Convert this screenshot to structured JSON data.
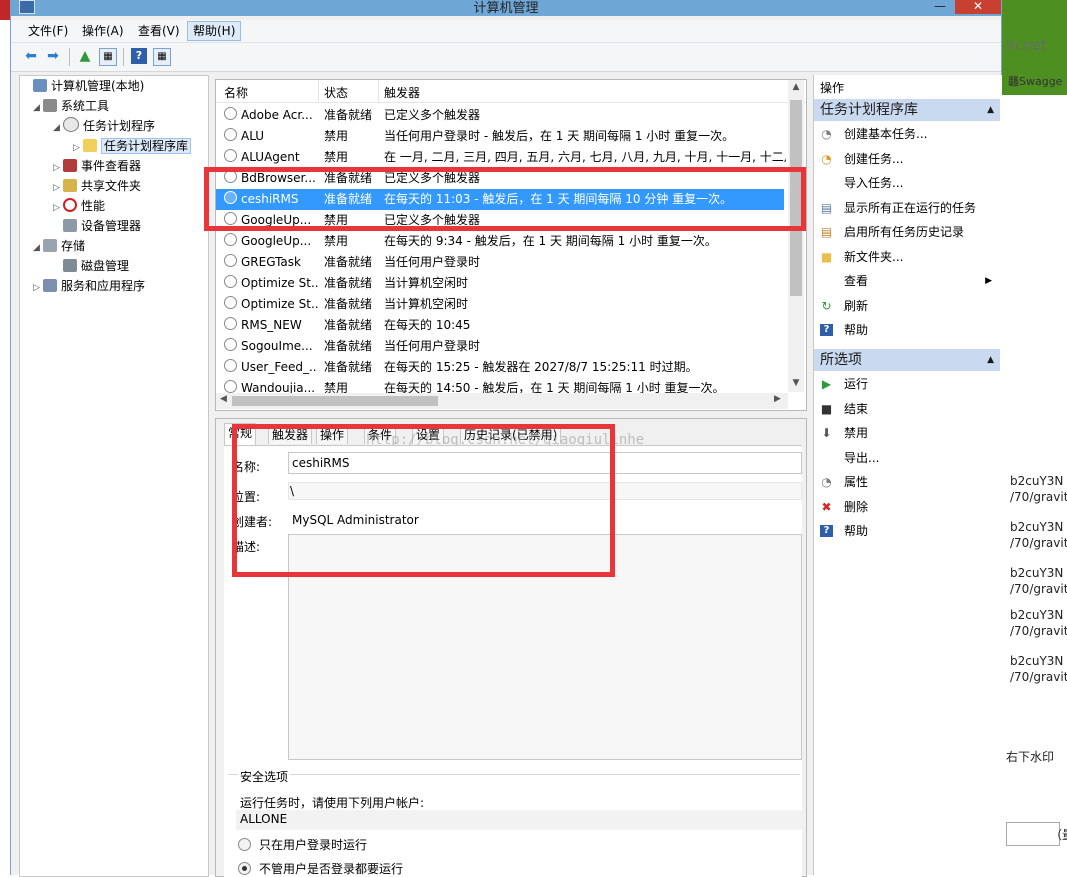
{
  "window": {
    "title": "计算机管理",
    "minimize": "—",
    "close": "✕"
  },
  "menubar": {
    "items": [
      "文件(F)",
      "操作(A)",
      "查看(V)",
      "帮助(H)"
    ]
  },
  "tree": {
    "items": [
      {
        "label": "计算机管理(本地)",
        "level": 0,
        "expander": "",
        "icon": "computer-icon"
      },
      {
        "label": "系统工具",
        "level": 1,
        "expander": "◢",
        "icon": "tools-icon"
      },
      {
        "label": "任务计划程序",
        "level": 2,
        "expander": "◢",
        "icon": "clock-icon"
      },
      {
        "label": "任务计划程序库",
        "level": 3,
        "expander": "▷",
        "icon": "folder-icon",
        "selected": true
      },
      {
        "label": "事件查看器",
        "level": 2,
        "expander": "▷",
        "icon": "event-viewer-icon"
      },
      {
        "label": "共享文件夹",
        "level": 2,
        "expander": "▷",
        "icon": "shared-folder-icon"
      },
      {
        "label": "性能",
        "level": 2,
        "expander": "▷",
        "icon": "performance-icon"
      },
      {
        "label": "设备管理器",
        "level": 2,
        "expander": "",
        "icon": "device-manager-icon"
      },
      {
        "label": "存储",
        "level": 1,
        "expander": "◢",
        "icon": "storage-icon"
      },
      {
        "label": "磁盘管理",
        "level": 2,
        "expander": "",
        "icon": "disk-icon"
      },
      {
        "label": "服务和应用程序",
        "level": 1,
        "expander": "▷",
        "icon": "services-icon"
      }
    ]
  },
  "tasklist": {
    "columns": [
      "名称",
      "状态",
      "触发器"
    ],
    "rows": [
      {
        "name": "Adobe Acr...",
        "status": "准备就绪",
        "trigger": "已定义多个触发器"
      },
      {
        "name": "ALU",
        "status": "禁用",
        "trigger": "当任何用户登录时 - 触发后，在 1 天 期间每隔 1 小时 重复一次。"
      },
      {
        "name": "ALUAgent",
        "status": "禁用",
        "trigger": "在 一月, 二月, 三月, 四月, 五月, 六月, 七月, 八月, 九月, 十月, 十一月, 十二月"
      },
      {
        "name": "BdBrowser...",
        "status": "准备就绪",
        "trigger": "已定义多个触发器"
      },
      {
        "name": "ceshiRMS",
        "status": "准备就绪",
        "trigger": "在每天的 11:03 - 触发后，在 1 天 期间每隔 10 分钟 重复一次。",
        "selected": true
      },
      {
        "name": "GoogleUp...",
        "status": "禁用",
        "trigger": "已定义多个触发器"
      },
      {
        "name": "GoogleUp...",
        "status": "禁用",
        "trigger": "在每天的 9:34 - 触发后，在 1 天 期间每隔 1 小时 重复一次。"
      },
      {
        "name": "GREGTask",
        "status": "准备就绪",
        "trigger": "当任何用户登录时"
      },
      {
        "name": "Optimize St...",
        "status": "准备就绪",
        "trigger": "当计算机空闲时"
      },
      {
        "name": "Optimize St...",
        "status": "准备就绪",
        "trigger": "当计算机空闲时"
      },
      {
        "name": "RMS_NEW",
        "status": "准备就绪",
        "trigger": "在每天的 10:45"
      },
      {
        "name": "SogouIme...",
        "status": "准备就绪",
        "trigger": "当任何用户登录时"
      },
      {
        "name": "User_Feed_...",
        "status": "准备就绪",
        "trigger": "在每天的 15:25 - 触发器在 2027/8/7 15:25:11 时过期。"
      },
      {
        "name": "Wandoujia...",
        "status": "禁用",
        "trigger": "在每天的 14:50 - 触发后，在 1 天 期间每隔 1 小时 重复一次。"
      }
    ]
  },
  "details": {
    "tabs": [
      "常规",
      "触发器",
      "操作",
      "条件",
      "设置",
      "历史记录(已禁用)"
    ],
    "watermark": "http://blog.csdn.net/qiaoqiulinhe",
    "name_label": "名称:",
    "name_value": "ceshiRMS",
    "location_label": "位置:",
    "location_value": "\\",
    "author_label": "创建者:",
    "author_value": "MySQL Administrator",
    "desc_label": "描述:",
    "security_label": "安全选项",
    "run_as_label": "运行任务时，请使用下列用户帐户:",
    "run_as_value": "ALLONE",
    "radio1": "只在用户登录时运行",
    "radio2": "不管用户是否登录都要运行"
  },
  "actions": {
    "header": "操作",
    "section1": "任务计划程序库",
    "section1_items": [
      {
        "label": "创建基本任务...",
        "icon": "create-basic-task-icon"
      },
      {
        "label": "创建任务...",
        "icon": "create-task-icon"
      },
      {
        "label": "导入任务...",
        "icon": ""
      },
      {
        "label": "显示所有正在运行的任务",
        "icon": "running-tasks-icon"
      },
      {
        "label": "启用所有任务历史记录",
        "icon": "history-icon"
      },
      {
        "label": "新文件夹...",
        "icon": "new-folder-icon"
      },
      {
        "label": "查看",
        "icon": "",
        "submenu": true
      },
      {
        "label": "刷新",
        "icon": "refresh-icon"
      },
      {
        "label": "帮助",
        "icon": "help-icon"
      }
    ],
    "section2": "所选项",
    "section2_items": [
      {
        "label": "运行",
        "icon": "run-icon"
      },
      {
        "label": "结束",
        "icon": "stop-icon"
      },
      {
        "label": "禁用",
        "icon": "disable-icon"
      },
      {
        "label": "导出...",
        "icon": ""
      },
      {
        "label": "属性",
        "icon": "properties-icon"
      },
      {
        "label": "删除",
        "icon": "delete-icon"
      },
      {
        "label": "帮助",
        "icon": "help-icon"
      }
    ]
  },
  "background": {
    "site": "ln.net",
    "swagger": "龘Swagge",
    "code_lines": [
      "b2cuY3N",
      "/70/gravit",
      "b2cuY3N",
      "/70/gravit",
      "b2cuY3N",
      "/70/gravit",
      "b2cuY3N",
      "/70/gravit",
      "b2cuY3N",
      "/70/gravit"
    ],
    "watermark_label": "右下水印",
    "paren": "（量"
  },
  "colors": {
    "selection": "#3399ff",
    "annotation_red": "#e8353a",
    "section_header": "#c9daf0"
  }
}
